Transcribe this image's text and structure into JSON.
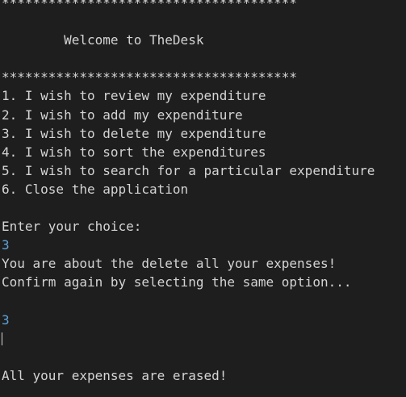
{
  "terminal": {
    "banner_top": "**************************************",
    "welcome": "        Welcome to TheDesk",
    "banner_bottom": "**************************************",
    "menu": [
      "1. I wish to review my expenditure",
      "2. I wish to add my expenditure",
      "3. I wish to delete my expenditure",
      "4. I wish to sort the expenditures",
      "5. I wish to search for a particular expenditure",
      "6. Close the application"
    ],
    "prompt": "Enter your choice:",
    "input_1": "3",
    "warning_1": "You are about the delete all your expenses!",
    "warning_2": "Confirm again by selecting the same option...",
    "input_2": "3",
    "list_output": "[]",
    "result": "All your expenses are erased!"
  },
  "colors": {
    "background": "#1e1e1e",
    "text": "#d4d4d4",
    "user_input": "#5fa3d6"
  }
}
